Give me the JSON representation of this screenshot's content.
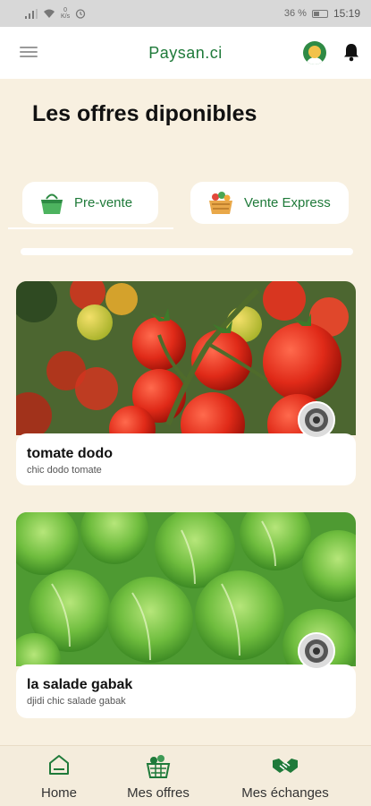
{
  "status_bar": {
    "network_kb": "0",
    "network_unit": "K/s",
    "battery": "36 %",
    "time": "15:19"
  },
  "app_bar": {
    "title": "Paysan.ci"
  },
  "main": {
    "title": "Les offres diponibles",
    "categories": [
      {
        "label": "Pre-vente",
        "icon": "basket-icon"
      },
      {
        "label": "Vente Express",
        "icon": "vegetable-basket-icon"
      }
    ],
    "offers": [
      {
        "name": "tomate dodo",
        "description": "chic dodo tomate",
        "image": "tomatoes-photo",
        "seller_icon": "seller-avatar"
      },
      {
        "name": "la salade gabak",
        "description": "djidi chic salade gabak",
        "image": "lettuce-photo",
        "seller_icon": "seller-avatar"
      }
    ]
  },
  "bottom_nav": [
    {
      "label": "Home",
      "icon": "home-icon"
    },
    {
      "label": "Mes offres",
      "icon": "produce-basket-icon"
    },
    {
      "label": "Mes échanges",
      "icon": "handshake-icon"
    }
  ],
  "colors": {
    "brand_green": "#1f7a3a",
    "page_bg": "#f8f0e0",
    "status_bar_bg": "#d8d8d8"
  }
}
